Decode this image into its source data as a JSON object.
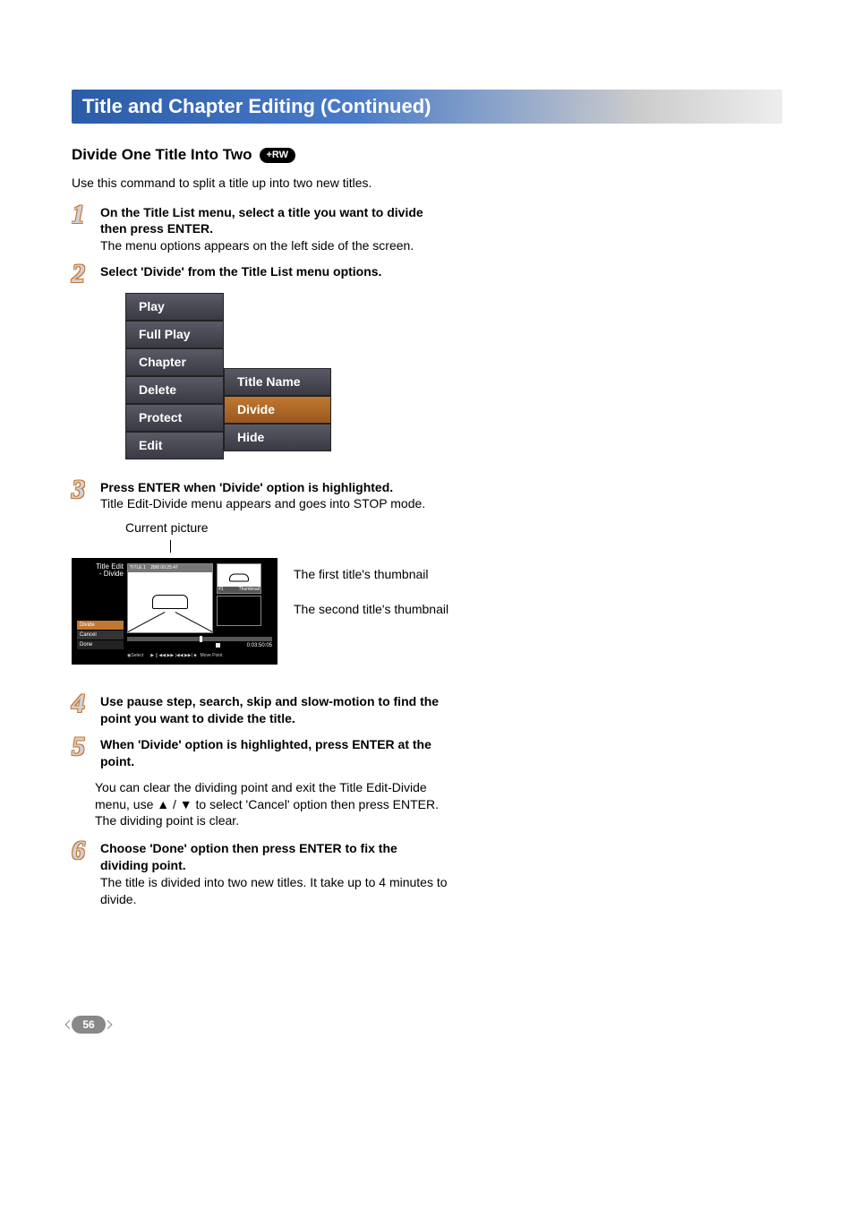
{
  "titlebar": "Title and Chapter Editing (Continued)",
  "subtitle": "Divide One Title Into Two",
  "badge": "+RW",
  "intro": "Use this command to split a title up into two new titles.",
  "steps": {
    "s1": {
      "bold": "On the Title List menu, select a title you want to divide then press ENTER.",
      "body": "The menu options appears on the left side of the screen."
    },
    "s2": {
      "bold": "Select 'Divide' from the Title List menu options."
    },
    "s3": {
      "bold": "Press ENTER when 'Divide' option is highlighted.",
      "body": "Title Edit-Divide menu appears and goes into STOP mode."
    },
    "s4": {
      "bold": "Use pause step, search, skip and slow-motion to find the point you want to divide the title."
    },
    "s5": {
      "bold": "When 'Divide' option is highlighted, press ENTER at the point."
    },
    "s5extra": "You can clear the dividing point and exit the Title Edit-Divide menu, use ▲ / ▼ to select 'Cancel' option then press ENTER. The dividing point is clear.",
    "s6": {
      "bold": "Choose 'Done' option then press ENTER to fix the dividing point.",
      "body": "The title is divided into two new titles. It take up to 4 minutes to divide."
    }
  },
  "menu": {
    "primary": [
      "Play",
      "Full Play",
      "Chapter",
      "Delete",
      "Protect",
      "Edit"
    ],
    "secondary": [
      "Title Name",
      "Divide",
      "Hide"
    ],
    "selected": "Divide"
  },
  "screen": {
    "cp_label": "Current picture",
    "side_title1": "Title Edit",
    "side_title2": "- Divide",
    "opt_divide": "Divide",
    "opt_cancel": "Cancel",
    "opt_done": "Done",
    "title_meta1": "TITLE 1",
    "title_meta2": "28/8  00:25:47",
    "thumb_num": "#1",
    "thumb_text": "Thumbnail",
    "time": "0:03:50:05",
    "bottom_select": "Select",
    "bottom_move": "Move Point",
    "label_first": "The first title's thumbnail",
    "label_second": "The second title's thumbnail"
  },
  "page": "56"
}
